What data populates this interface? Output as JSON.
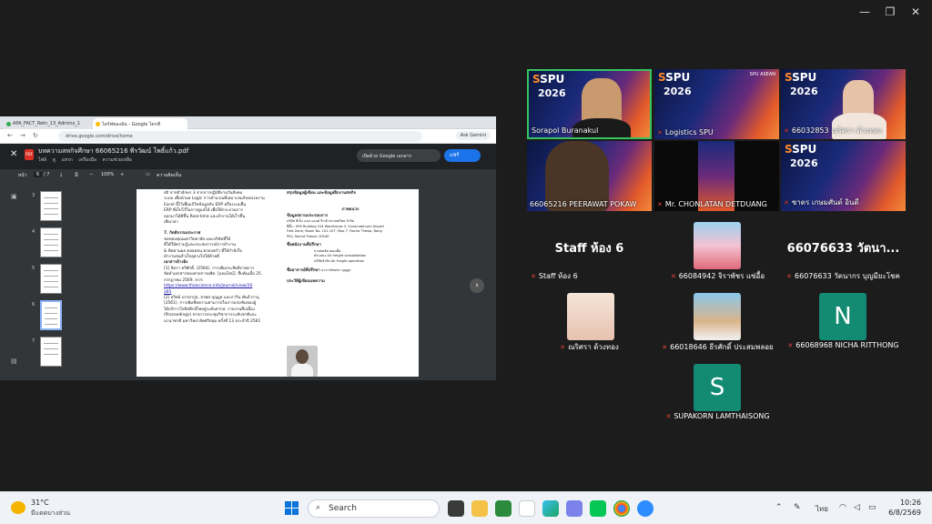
{
  "window": {
    "minimize": "—",
    "restore": "❐",
    "close": "✕"
  },
  "browser": {
    "tabs": [
      {
        "label": "APA_FACT_Retn_13_Admins_1"
      },
      {
        "label": "ไดร์ฟของฉัน - Google ไดรฟ์"
      }
    ],
    "url": "drive.google.com/drive/home",
    "ask_gemini": "Ask Gemini"
  },
  "viewer": {
    "title": "บทความสหกิจศึกษา 66065216 พีรวัฒน์ โพธิ์แก้ว.pdf",
    "menu": [
      "ไฟล์",
      "ดู",
      "แทรก",
      "เครื่องมือ",
      "ความช่วยเหลือ"
    ],
    "open_with": "เปิดด้วย Google เอกสาร",
    "share": "แชร์",
    "page_label": "หน้า",
    "page_current": "6",
    "page_total": "/ 7",
    "zoom": "100%",
    "comment": "ความคิดเห็น",
    "thumb_numbers": [
      "3",
      "4",
      "5",
      "6",
      "7"
    ],
    "doc_left": [
      "สถิ จากตัวอักษร 3 จากการปฏิบัติงานวันสังคม",
      "ระบบ เพื่อนำผล Logic การคำนวณที่เหมาะสมกับหน่วยงาน",
      "Excel นี้ไว้เพื่อแก้ไขข้อมูลกับ ERP หรือระบบอื่น",
      "ERP ที่เก็บไว้ในการดูแลได้ เพื่อให้กระบวนการ",
      "ออกมาได้ดีขึ้น Real-time และทำงานได้เร็วขึ้น",
      "เสียเวลา"
    ],
    "sec7": "7. กิตติกรรมประกาศ",
    "sec7_body": [
      "ขอขอบคุณมหาวิทยาลัย และบริษัทที่ให้",
      "ที่ได้ให้ความรู้และประสบการณ์การทำงาน",
      "& ติดตามผล ตลอดจน ครอบครัว ที่ให้กำลังใจ",
      "ทำงานจนสำเร็จลุล่วงไปได้ด้วยดี"
    ],
    "refs_head": "เอกสารอ้างอิง",
    "ref1": [
      "[1] จิตรา ทวีศักดิ์. (2564). การเพิ่มประสิทธิภาพการ",
      "จัดทำเอกสารของสายการผลิต. [ออนไลน์]. สืบค้นเมื่อ 25",
      "กรกฎาคม 2569, จาก:"
    ],
    "ref1_link": "https://www.thaiscience.info/journal/view/20",
    "ref1_link2": "285",
    "ref2": [
      "[2] สุวิตย์ บรรยากูล, สวพล บุญมูล และกาวิน พันธ์วรานุ",
      "(2561). การเพิ่มขีดความสามารถในการแข่งขันของผู้",
      "ได้บริการโลจิสติกส์ไทยสู่ระดับสากล. รายงานสืบเนื่อง",
      "(Proceedings) จากการประชุมวิชาการระดับชาติและ",
      "นานาชาติ มหาวิทยาลัยศรีปทุม ครั้งที่ 13 ประจำปี 2561"
    ],
    "right_top": "สรุปข้อมูลผู้เขียน และข้อมูลฝึกงานสหกิจ",
    "about_head": "ภาคผนวก",
    "company_head": "ข้อมูลสถานประกอบการ",
    "company": [
      "บริษัท ลีเอ็ก แอป แอนด์ รีเกอิ ประเทศไทย จำกัด",
      "ที่ตั้ง : 999 Building 314 Warehouse 3, Suvarnabhumi Airport",
      "Free Zone, Room No. 101-107, Moo 7, Racha Thewa, Bang",
      "Phli, Samut Prakan 10540"
    ],
    "mentor_head": "ชื่อพนักงานที่ปรึกษา",
    "mentor": [
      "นายสมชัย สอนเพื่อ",
      "ตำแหน่ง Air freight consolidation",
      "บริษัทจำกัด Air freight operation"
    ],
    "advisor_head": "ชื่ออาจารย์ที่ปรึกษา",
    "advisor": "อาจารย์ชลธร บุญมูล",
    "history_head": "ประวัติผู้เขียนบทความ"
  },
  "participants": {
    "row1": [
      {
        "name": "Sorapol Buranakul",
        "muted": false
      },
      {
        "name": "Logistics SPU",
        "muted": true
      },
      {
        "name": "66032853 ณริศรา ด้วงทอง",
        "muted": true
      }
    ],
    "row2": [
      {
        "name": "66065216 PEERAWAT POKAW",
        "muted": false
      },
      {
        "name": "Mr. CHONLATAN DETDUANG",
        "muted": true
      },
      {
        "name": "ชาตร เกษมศันต์ อินดี",
        "muted": true
      }
    ],
    "staff_big": "Staff ห้อง 6",
    "staff_label": "Staff ห้อง 6",
    "p1_label": "66084942 จิราพัชร แซ่อื้อ",
    "p2_big": "66076633 วัตนา...",
    "p2_label": "66076633 วัตนากร บุญมียะโชค",
    "p3_label": "ณริศรา ด้วงทอง",
    "p4_label": "66018646 ธีรศักดิ์ ประสมพลอย",
    "p5_letter": "N",
    "p5_label": "66068968 NICHA RITTHONG",
    "p6_letter": "S",
    "p6_label": "SUPAKORN LAMTHAISONG",
    "spu_logo": "SPU",
    "spu_year": "2026",
    "spu_brand": "SPU ASEAN"
  },
  "taskbar": {
    "temp": "31°C",
    "weather": "มีแดดบางส่วน",
    "search_placeholder": "Search",
    "lang": "ไทย",
    "time": "10:26",
    "date": "6/8/2569"
  },
  "colors": {
    "accent_green": "#35c45e",
    "mute_red": "#e8453c",
    "avatar_green": "#138a72"
  }
}
